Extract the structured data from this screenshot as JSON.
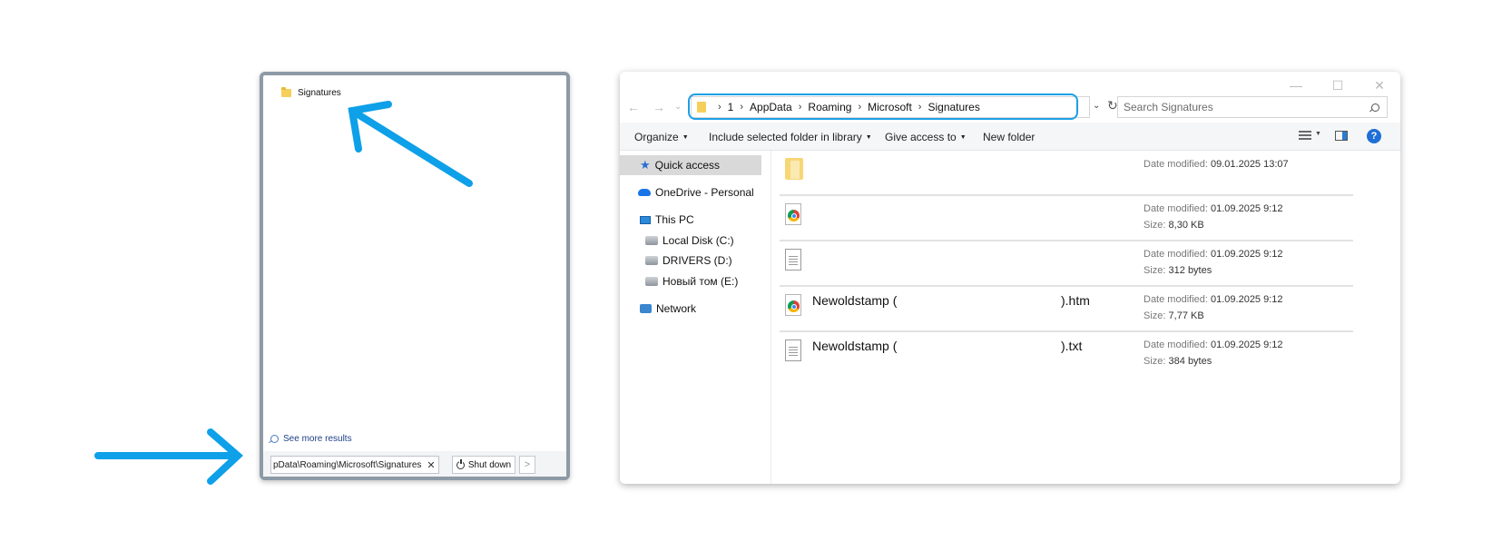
{
  "start_menu": {
    "result_label": "Signatures",
    "see_more": "See more results",
    "search_value": "pData\\Roaming\\Microsoft\\Signatures",
    "clear_glyph": "✕",
    "shutdown_label": "Shut down",
    "shutdown_arrow": ">"
  },
  "explorer": {
    "window_controls": {
      "minimize": "—",
      "maximize": "☐",
      "close": "✕"
    },
    "nav": {
      "back": "←",
      "forward": "→",
      "recent": "⌄"
    },
    "breadcrumb": [
      "1",
      "AppData",
      "Roaming",
      "Microsoft",
      "Signatures"
    ],
    "search_placeholder": "Search Signatures",
    "toolbar": {
      "organize": "Organize",
      "include_library": "Include selected folder in library",
      "give_access": "Give access to",
      "new_folder": "New folder",
      "help": "?"
    },
    "sidebar": [
      {
        "label": "Quick access",
        "icon": "star-icon"
      },
      {
        "label": "OneDrive - Personal",
        "icon": "cloud-icon"
      },
      {
        "label": "This PC",
        "icon": "pc-icon"
      },
      {
        "label": "Local Disk (C:)",
        "icon": "disk-icon"
      },
      {
        "label": "DRIVERS (D:)",
        "icon": "disk-icon"
      },
      {
        "label": "Новый том (E:)",
        "icon": "disk-icon"
      },
      {
        "label": "Network",
        "icon": "network-icon"
      }
    ],
    "files": [
      {
        "name": "",
        "ext": "",
        "icon": "folder-icon",
        "date_label": "Date modified:",
        "date": "09.01.2025 13:07",
        "size_label": "",
        "size": ""
      },
      {
        "name": "",
        "ext": "",
        "icon": "chrome-file-icon",
        "date_label": "Date modified:",
        "date": "01.09.2025 9:12",
        "size_label": "Size:",
        "size": "8,30 KB"
      },
      {
        "name": "",
        "ext": "",
        "icon": "text-file-icon",
        "date_label": "Date modified:",
        "date": "01.09.2025 9:12",
        "size_label": "Size:",
        "size": "312 bytes"
      },
      {
        "name": "Newoldstamp (",
        "ext": ").htm",
        "icon": "chrome-file-icon",
        "date_label": "Date modified:",
        "date": "01.09.2025 9:12",
        "size_label": "Size:",
        "size": "7,77 KB"
      },
      {
        "name": "Newoldstamp (",
        "ext": ").txt",
        "icon": "text-file-icon",
        "date_label": "Date modified:",
        "date": "01.09.2025 9:12",
        "size_label": "Size:",
        "size": "384 bytes"
      }
    ]
  },
  "colors": {
    "highlight": "#1e9fe6",
    "arrow": "#0ea0e8"
  }
}
